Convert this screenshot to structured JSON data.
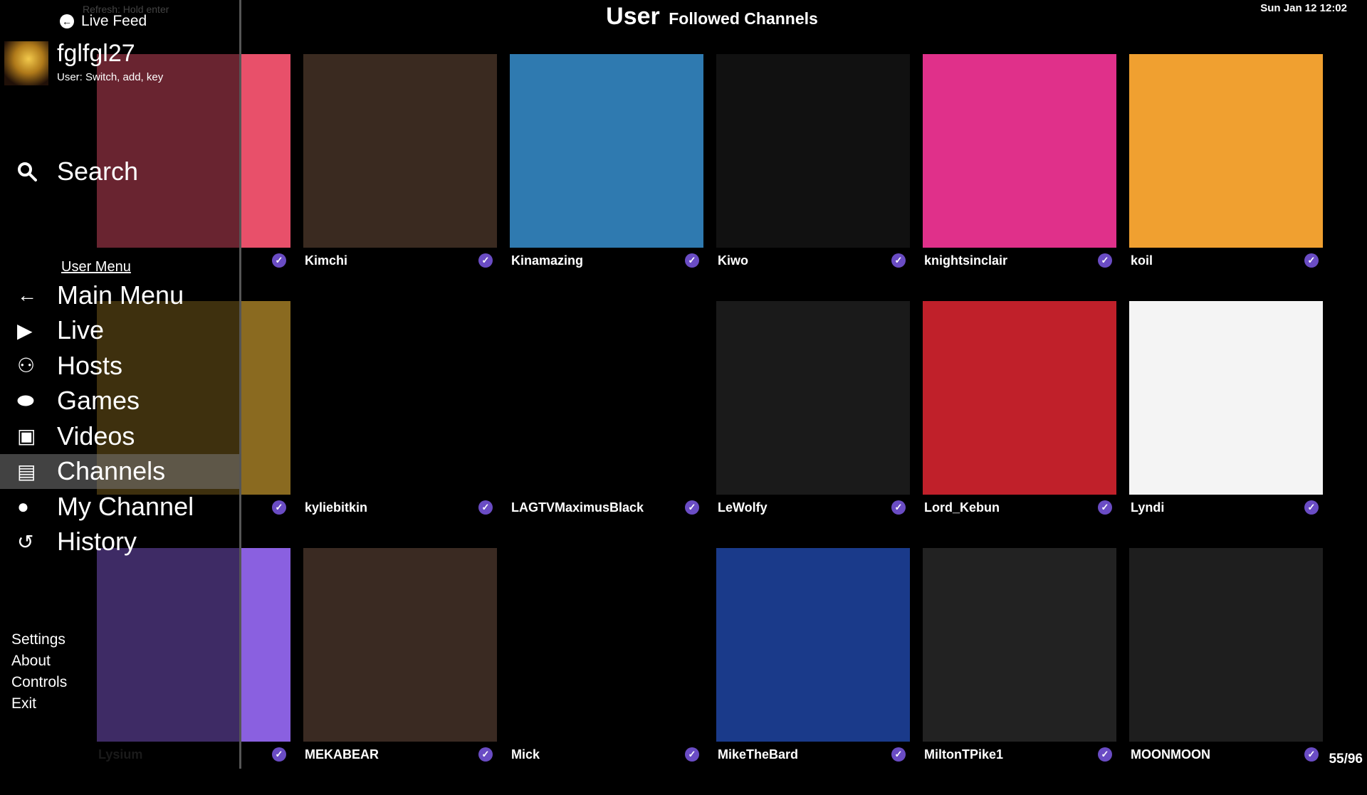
{
  "header": {
    "title": "User",
    "subtitle": "Followed Channels",
    "clock": "Sun Jan 12 12:02",
    "page_count": "55/96"
  },
  "sidebar": {
    "refresh_hint": "Refresh: Hold enter",
    "live_feed": "Live Feed",
    "username": "fglfgl27",
    "user_hint": "User: Switch, add, key",
    "search": "Search",
    "menu_header": "User Menu",
    "menu_items": [
      {
        "label": "Main Menu",
        "icon": "arrow-left-icon"
      },
      {
        "label": "Live",
        "icon": "play-icon"
      },
      {
        "label": "Hosts",
        "icon": "group-icon"
      },
      {
        "label": "Games",
        "icon": "gamepad-icon"
      },
      {
        "label": "Videos",
        "icon": "video-icon"
      },
      {
        "label": "Channels",
        "icon": "film-icon",
        "selected": true
      },
      {
        "label": "My Channel",
        "icon": "user-icon"
      },
      {
        "label": "History",
        "icon": "history-icon"
      }
    ],
    "footer_links": [
      "Settings",
      "About",
      "Controls",
      "Exit"
    ]
  },
  "channels": [
    {
      "name": "",
      "color": "#e8506a",
      "dim": true
    },
    {
      "name": "Kimchi",
      "color": "#3a2a20"
    },
    {
      "name": "Kinamazing",
      "color": "#2f7ab0"
    },
    {
      "name": "Kiwo",
      "color": "#111111"
    },
    {
      "name": "knightsinclair",
      "color": "#e0308a"
    },
    {
      "name": "koil",
      "color": "#f0a030"
    },
    {
      "name": "",
      "color": "#8a6a20",
      "dim": true
    },
    {
      "name": "kyliebitkin",
      "color": "#000000"
    },
    {
      "name": "LAGTVMaximusBlack",
      "color": "#000000"
    },
    {
      "name": "LeWolfy",
      "color": "#1a1a1a"
    },
    {
      "name": "Lord_Kebun",
      "color": "#c0202a"
    },
    {
      "name": "Lyndi",
      "color": "#f4f4f4"
    },
    {
      "name": "Lysium",
      "color": "#8a60e0",
      "dim": true
    },
    {
      "name": "MEKABEAR",
      "color": "#3a2a22"
    },
    {
      "name": "Mick",
      "color": "#000000"
    },
    {
      "name": "MikeTheBard",
      "color": "#1a3a8a"
    },
    {
      "name": "MiltonTPike1",
      "color": "#222222"
    },
    {
      "name": "MOONMOON",
      "color": "#1e1e1e"
    }
  ],
  "verified_icon": "verified-check-icon"
}
